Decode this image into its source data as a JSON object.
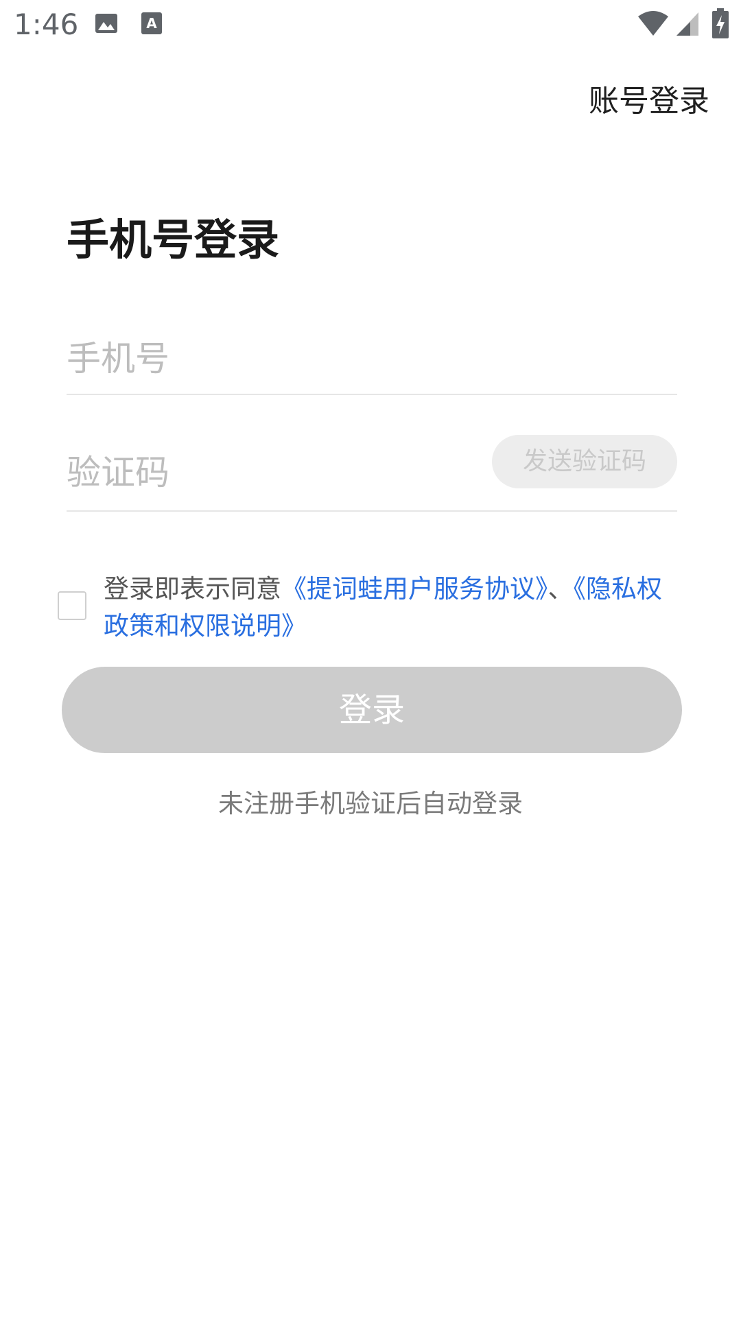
{
  "status_bar": {
    "time": "1:46",
    "icons": [
      "image-icon",
      "font-a-icon",
      "wifi-icon",
      "signal-icon",
      "battery-charging-icon"
    ]
  },
  "header": {
    "account_login": "账号登录"
  },
  "main": {
    "title": "手机号登录",
    "phone_placeholder": "手机号",
    "code_placeholder": "验证码",
    "send_code_label": "发送验证码",
    "agreement": {
      "prefix": "登录即表示同意",
      "link1": "《提词蛙用户服务协议》",
      "separator": "、",
      "link2": "《隐私权政策和权限说明》",
      "checked": false
    },
    "login_label": "登录",
    "hint": "未注册手机验证后自动登录"
  },
  "colors": {
    "link": "#2a6fe0",
    "button_disabled": "#cccccc"
  }
}
